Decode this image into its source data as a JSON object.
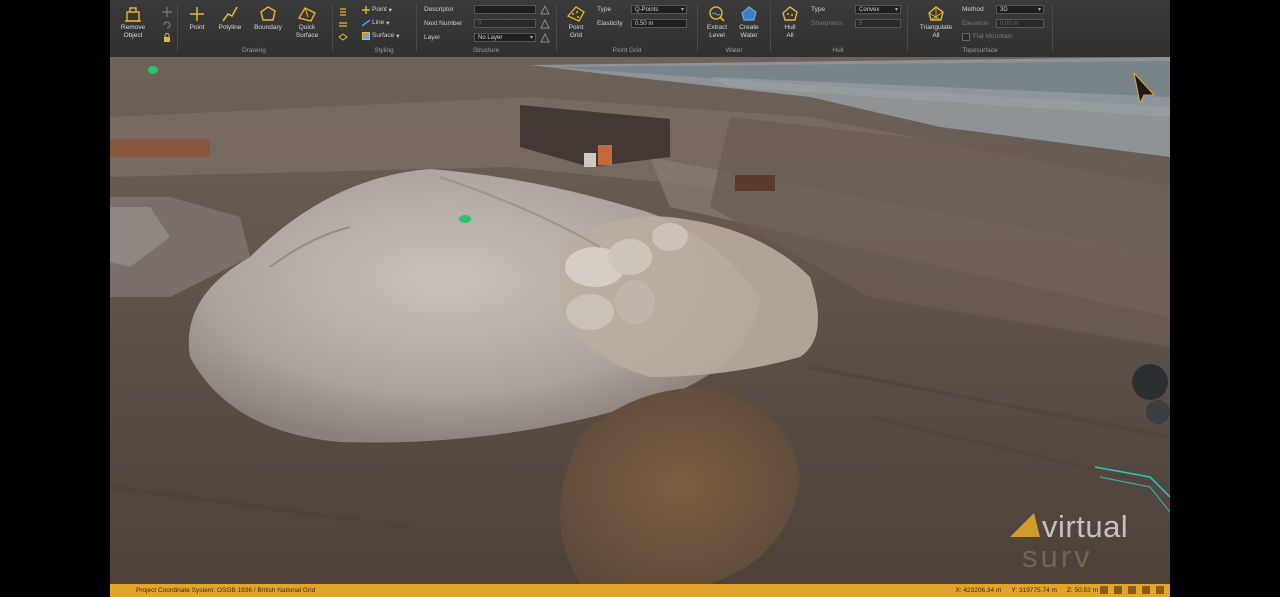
{
  "ribbon": {
    "remove_object": "Remove\nObject",
    "drawing": {
      "label": "Drawing",
      "point": "Point",
      "polyline": "Polyline",
      "boundary": "Boundary",
      "quick_surface": "Quick\nSurface"
    },
    "styling": {
      "label": "Styling",
      "point": "Point",
      "line": "Line",
      "surface": "Surface"
    },
    "structure": {
      "label": "Structure",
      "descriptor_label": "Descriptor",
      "descriptor_value": "",
      "next_number_label": "Next Number",
      "next_number_value": "0",
      "layer_label": "Layer",
      "layer_value": "No Layer"
    },
    "point_grid": {
      "label": "Point Grid",
      "button": "Point\nGrid",
      "type_label": "Type",
      "type_value": "Q-Points",
      "elasticity_label": "Elasticity",
      "elasticity_value": "0.50 m"
    },
    "water": {
      "label": "Water",
      "extract_level": "Extract\nLevel",
      "create_water": "Create\nWater"
    },
    "hull": {
      "label": "Hull",
      "hull_all": "Hull\nAll",
      "type_label": "Type",
      "type_value": "Convex",
      "sharpness_label": "Sharpness",
      "sharpness_value": "5"
    },
    "toposurface": {
      "label": "Toposurface",
      "triangulate_all": "Triangulate\nAll",
      "method_label": "Method",
      "method_value": "3D",
      "elevation_label": "Elevation",
      "elevation_value": "0.00 m",
      "flat_mountain": "Flat Mountain"
    }
  },
  "statusbar": {
    "coordinate_system": "Project Coordinate System:  OSGB 1936 / British National Grid",
    "x": "X: 423206.34 m",
    "y": "Y: 319775.74 m",
    "z": "Z: 50.53 m"
  },
  "watermark": {
    "line1": "virtual",
    "line2": "surv"
  },
  "colors": {
    "ribbon_bg": "#333333",
    "accent": "#e0a52a",
    "icon": "#e8b52e"
  }
}
